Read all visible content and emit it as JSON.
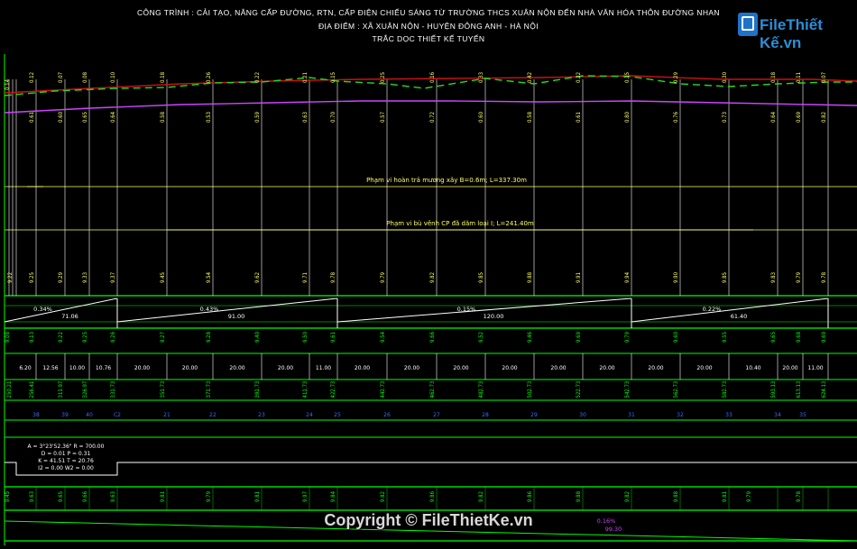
{
  "header": {
    "line1": "CÔNG TRÌNH : CẢI TẠO, NÂNG CẤP ĐƯỜNG, RTN, CẤP ĐIỆN CHIẾU SÁNG TỪ TRƯỜNG THCS XUÂN NỘN ĐẾN NHÀ VĂN HÓA THÔN ĐƯỜNG NHAN",
    "line2": "ĐỊA ĐIỂM : XÃ XUÂN NỘN - HUYỆN ĐÔNG ANH - HÀ NỘI",
    "line3": "TRẮC DỌC THIẾT KẾ TUYẾN"
  },
  "logo": {
    "text": "FileThiết Kế.vn"
  },
  "copyright": "Copyright © FileThietKe.vn",
  "colors": {
    "grid": "#00ff00",
    "white": "#ffffff",
    "yellow": "#ffff66",
    "magenta": "#cc44ff",
    "red": "#cc1111",
    "dash": "#22dd22",
    "blue": "#4466ff"
  },
  "stations": [
    {
      "top": "0.12",
      "mid": "0.61",
      "bot": "9.25",
      "cv": "9.13",
      "dist": "12.56",
      "cum": "256.41",
      "km": "38"
    },
    {
      "top": "0.07",
      "mid": "0.60",
      "bot": "9.29",
      "cv": "9.22",
      "dist": "10.00",
      "cum": "311.97",
      "km": "39"
    },
    {
      "top": "0.08",
      "mid": "0.65",
      "bot": "9.33",
      "cv": "9.25",
      "dist": "10.76",
      "cum": "326.97",
      "km": "40"
    },
    {
      "top": "0.10",
      "mid": "0.64",
      "bot": "9.37",
      "cv": "9.26",
      "dist": "20.00",
      "cum": "331.73",
      "km": "C2"
    },
    {
      "top": "0.18",
      "mid": "0.58",
      "bot": "9.45",
      "cv": "9.27",
      "dist": "20.00",
      "cum": "351.73",
      "km": "21"
    },
    {
      "top": "0.26",
      "mid": "0.53",
      "bot": "9.54",
      "cv": "9.28",
      "dist": "20.00",
      "cum": "371.73",
      "km": "22"
    },
    {
      "top": "0.22",
      "mid": "0.59",
      "bot": "9.62",
      "cv": "9.40",
      "dist": "20.00",
      "cum": "391.73",
      "km": "23"
    },
    {
      "top": "0.21",
      "mid": "0.63",
      "bot": "9.71",
      "cv": "9.50",
      "dist": "11.00",
      "cum": "411.73",
      "km": "24"
    },
    {
      "top": "0.15",
      "mid": "0.70",
      "bot": "9.78",
      "cv": "9.61",
      "dist": "20.00",
      "cum": "422.73",
      "km": "25"
    },
    {
      "top": "0.25",
      "mid": "0.57",
      "bot": "9.79",
      "cv": "9.54",
      "dist": "20.00",
      "cum": "442.73",
      "km": "26"
    },
    {
      "top": "0.16",
      "mid": "0.72",
      "bot": "9.82",
      "cv": "9.66",
      "dist": "20.00",
      "cum": "462.73",
      "km": "27"
    },
    {
      "top": "0.33",
      "mid": "0.60",
      "bot": "9.85",
      "cv": "9.52",
      "dist": "20.00",
      "cum": "482.73",
      "km": "28"
    },
    {
      "top": "0.42",
      "mid": "0.58",
      "bot": "9.88",
      "cv": "9.46",
      "dist": "20.00",
      "cum": "502.73",
      "km": "29"
    },
    {
      "top": "0.22",
      "mid": "0.61",
      "bot": "9.91",
      "cv": "9.69",
      "dist": "20.00",
      "cum": "522.73",
      "km": "30"
    },
    {
      "top": "0.15",
      "mid": "0.80",
      "bot": "9.94",
      "cv": "9.79",
      "dist": "20.00",
      "cum": "542.73",
      "km": "31"
    },
    {
      "top": "0.29",
      "mid": "0.76",
      "bot": "9.90",
      "cv": "9.60",
      "dist": "20.00",
      "cum": "562.73",
      "km": "32"
    },
    {
      "top": "0.30",
      "mid": "0.73",
      "bot": "9.85",
      "cv": "9.55",
      "dist": "10.40",
      "cum": "582.73",
      "km": "33"
    },
    {
      "top": "0.18",
      "mid": "0.64",
      "bot": "9.83",
      "cv": "9.65",
      "dist": "20.00",
      "cum": "593.13",
      "km": "34"
    },
    {
      "top": "0.11",
      "mid": "0.69",
      "bot": "9.79",
      "cv": "9.68",
      "dist": "11.00",
      "cum": "613.13",
      "km": "35"
    },
    {
      "top": "0.07",
      "mid": "0.82",
      "bot": "9.78",
      "cv": "9.69",
      "dist": "",
      "cum": "624.13",
      "km": ""
    }
  ],
  "left_values": {
    "top": "0.14",
    "bot": "9.22",
    "cv": "9.08",
    "dist": "6.20",
    "cum": "250.21"
  },
  "range1": "Phạm vi hoàn trả mương xây B=0.6m; L=337.30m",
  "range2": "Phạm vi bù vênh CP đã dăm loại I; L=241.40m",
  "slopes": [
    {
      "pct": "0.34%",
      "len": "71.06"
    },
    {
      "pct": "0.43%",
      "len": "91.00"
    },
    {
      "pct": "0.15%",
      "len": "120.00"
    },
    {
      "pct": "0.22%",
      "len": "61.40"
    }
  ],
  "curve": {
    "l1": "A = 3°23'52.36\" R = 700.00",
    "l2": "D = 0.01 P = 0.31",
    "l3": "K = 41.51 T = 20.76",
    "l4": "I2 = 0.00 W2 = 0.00"
  },
  "bottom_row": [
    "9.63",
    "9.65",
    "9.66",
    "9.63",
    "9.81",
    "9.79",
    "9.81",
    "9.97",
    "9.84",
    "9.82",
    "9.86",
    "9.82",
    "9.86",
    "9.88",
    "9.82",
    "9.88",
    "9.81",
    "9.79",
    "9.78"
  ],
  "bottom_slope": {
    "pct": "0.16%",
    "len": "99.30"
  }
}
